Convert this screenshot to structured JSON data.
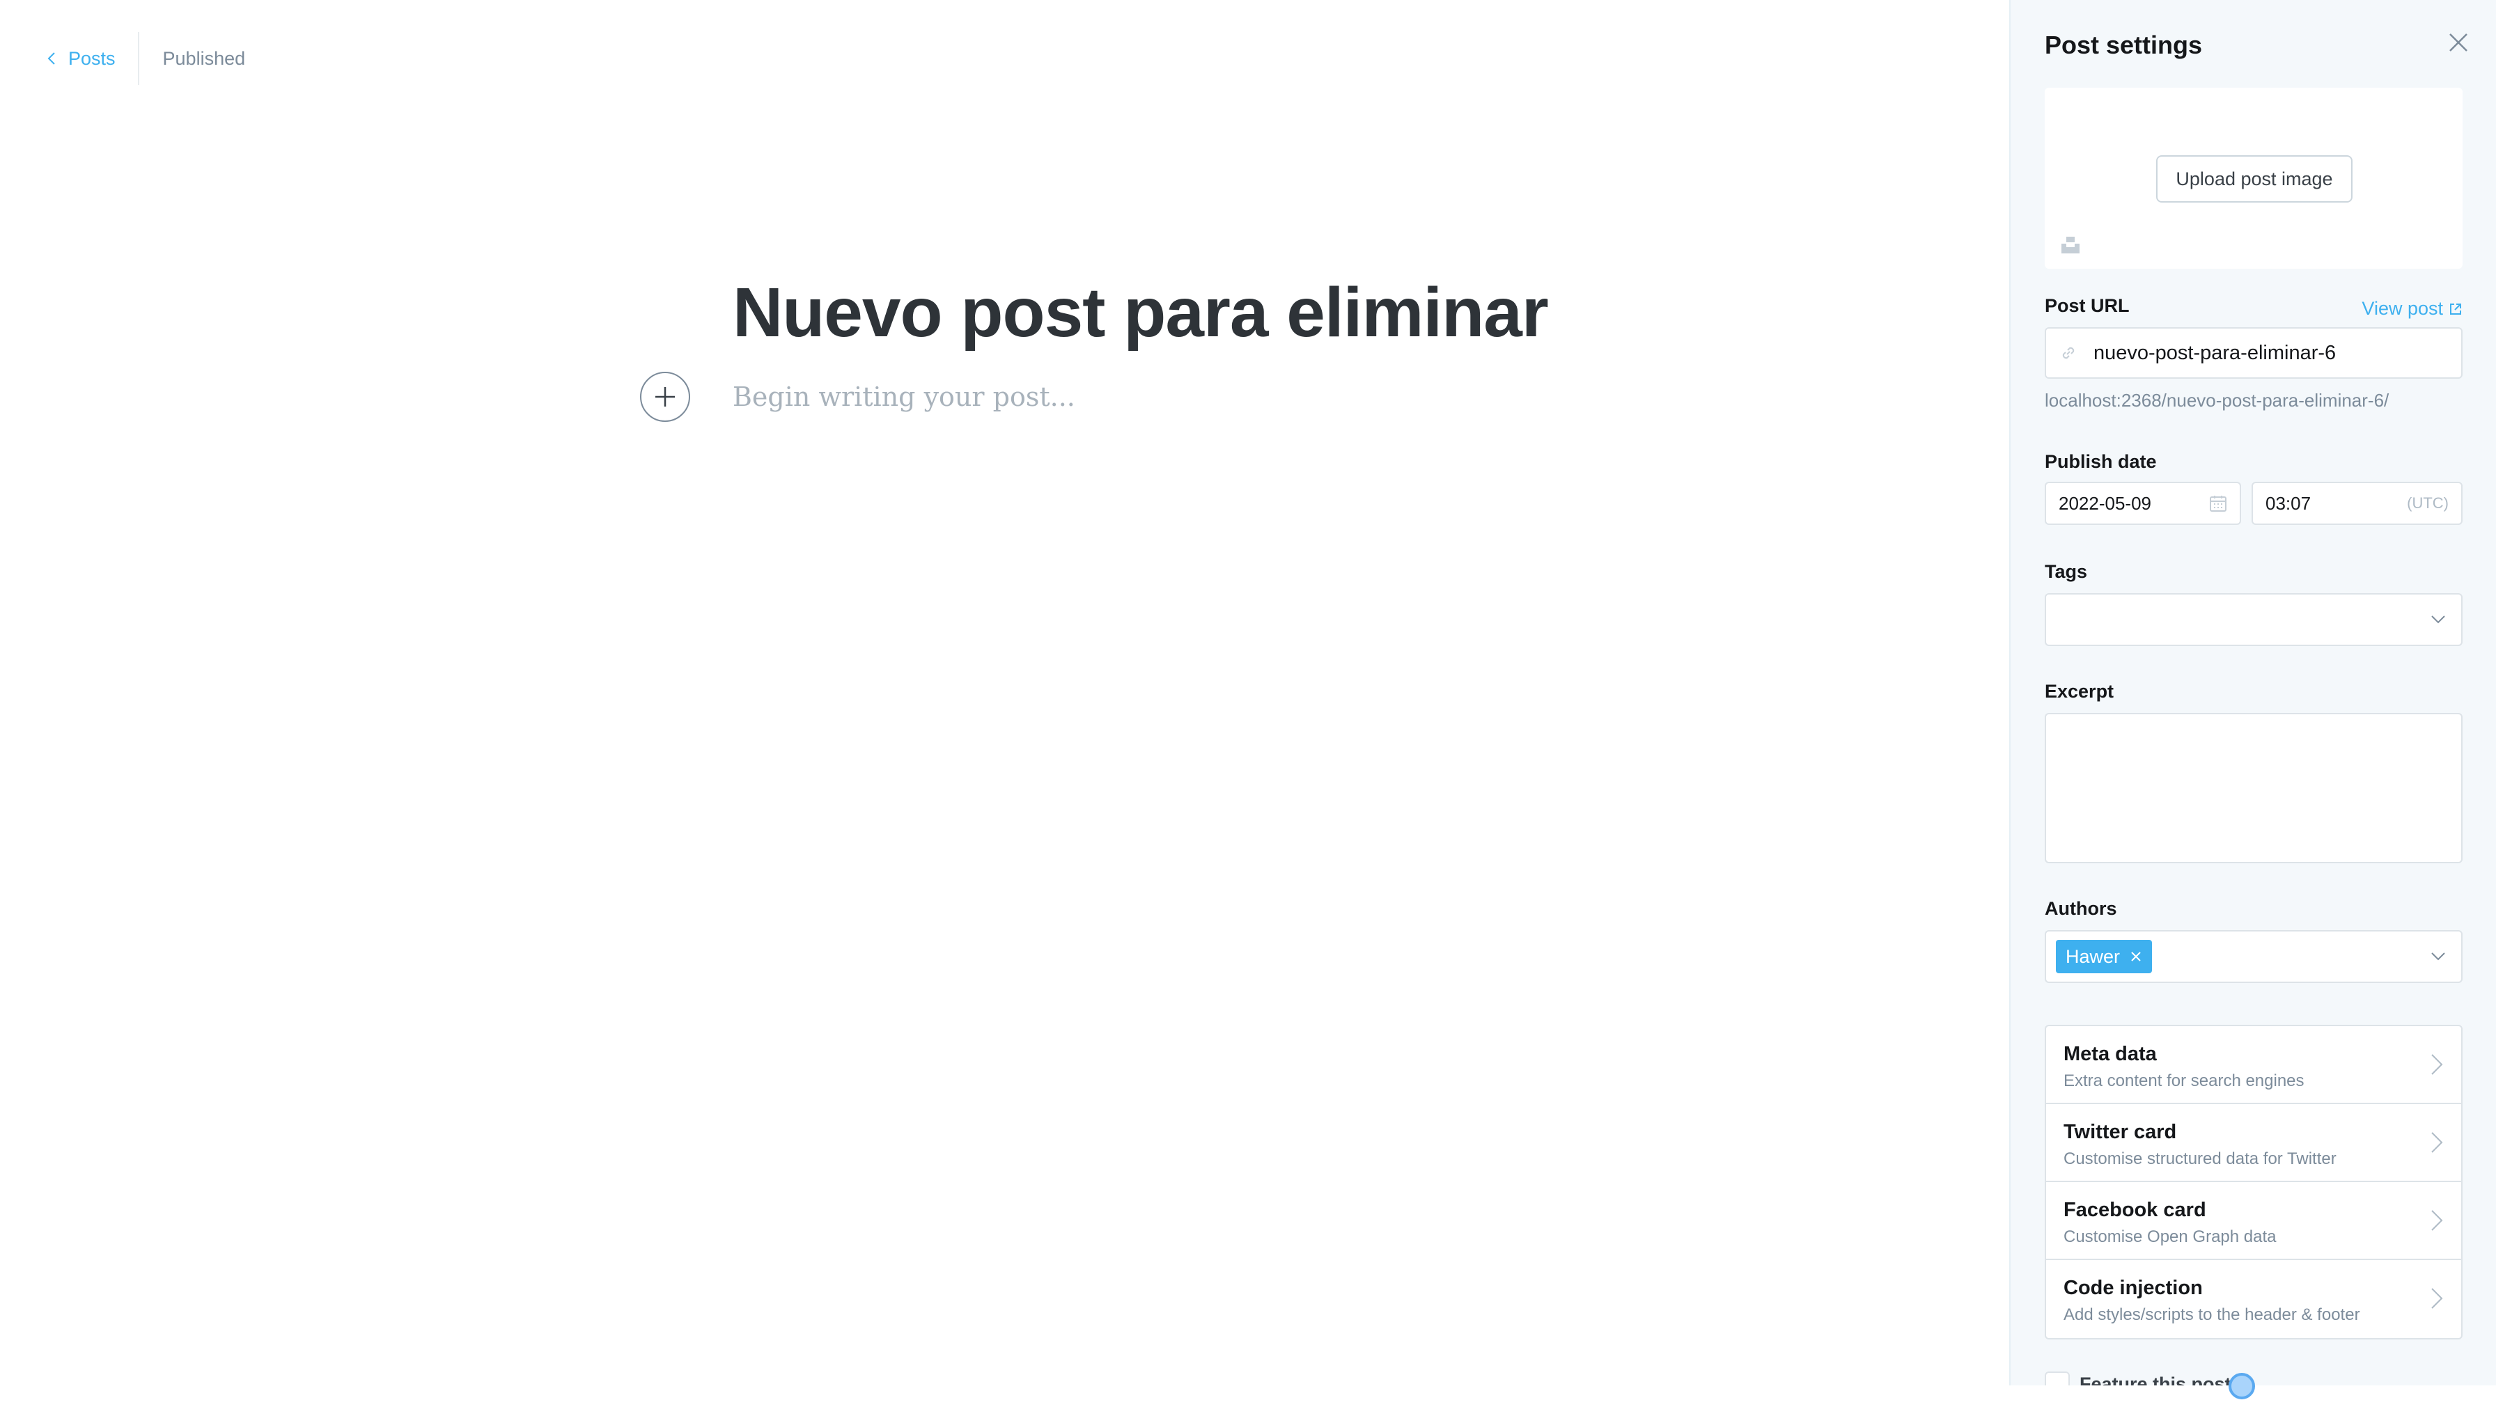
{
  "editor": {
    "back_label": "Posts",
    "status": "Published",
    "title": "Nuevo post para eliminar",
    "body_placeholder": "Begin writing your post..."
  },
  "sidebar": {
    "title": "Post settings",
    "upload_label": "Upload post image",
    "post_url": {
      "label": "Post URL",
      "view_post": "View post",
      "value": "nuevo-post-para-eliminar-6",
      "hint": "localhost:2368/nuevo-post-para-eliminar-6/"
    },
    "publish_date": {
      "label": "Publish date",
      "date": "2022-05-09",
      "time": "03:07",
      "timezone": "(UTC)"
    },
    "tags": {
      "label": "Tags",
      "value": ""
    },
    "excerpt": {
      "label": "Excerpt",
      "value": ""
    },
    "authors": {
      "label": "Authors",
      "items": [
        "Hawer"
      ]
    },
    "nav_items": [
      {
        "title": "Meta data",
        "desc": "Extra content for search engines"
      },
      {
        "title": "Twitter card",
        "desc": "Customise structured data for Twitter"
      },
      {
        "title": "Facebook card",
        "desc": "Customise Open Graph data"
      },
      {
        "title": "Code injection",
        "desc": "Add styles/scripts to the header & footer"
      }
    ],
    "feature_label": "Feature this post"
  },
  "colors": {
    "accent": "#3eb0ef",
    "sidebar_bg": "#f4f8fb",
    "title": "#2e3338",
    "muted": "#7c8b9a"
  },
  "icons": [
    "chevron-left-icon",
    "plus-icon",
    "close-icon",
    "unsplash-icon",
    "external-link-icon",
    "link-icon",
    "calendar-icon",
    "chevron-down-icon",
    "chevron-right-icon"
  ]
}
